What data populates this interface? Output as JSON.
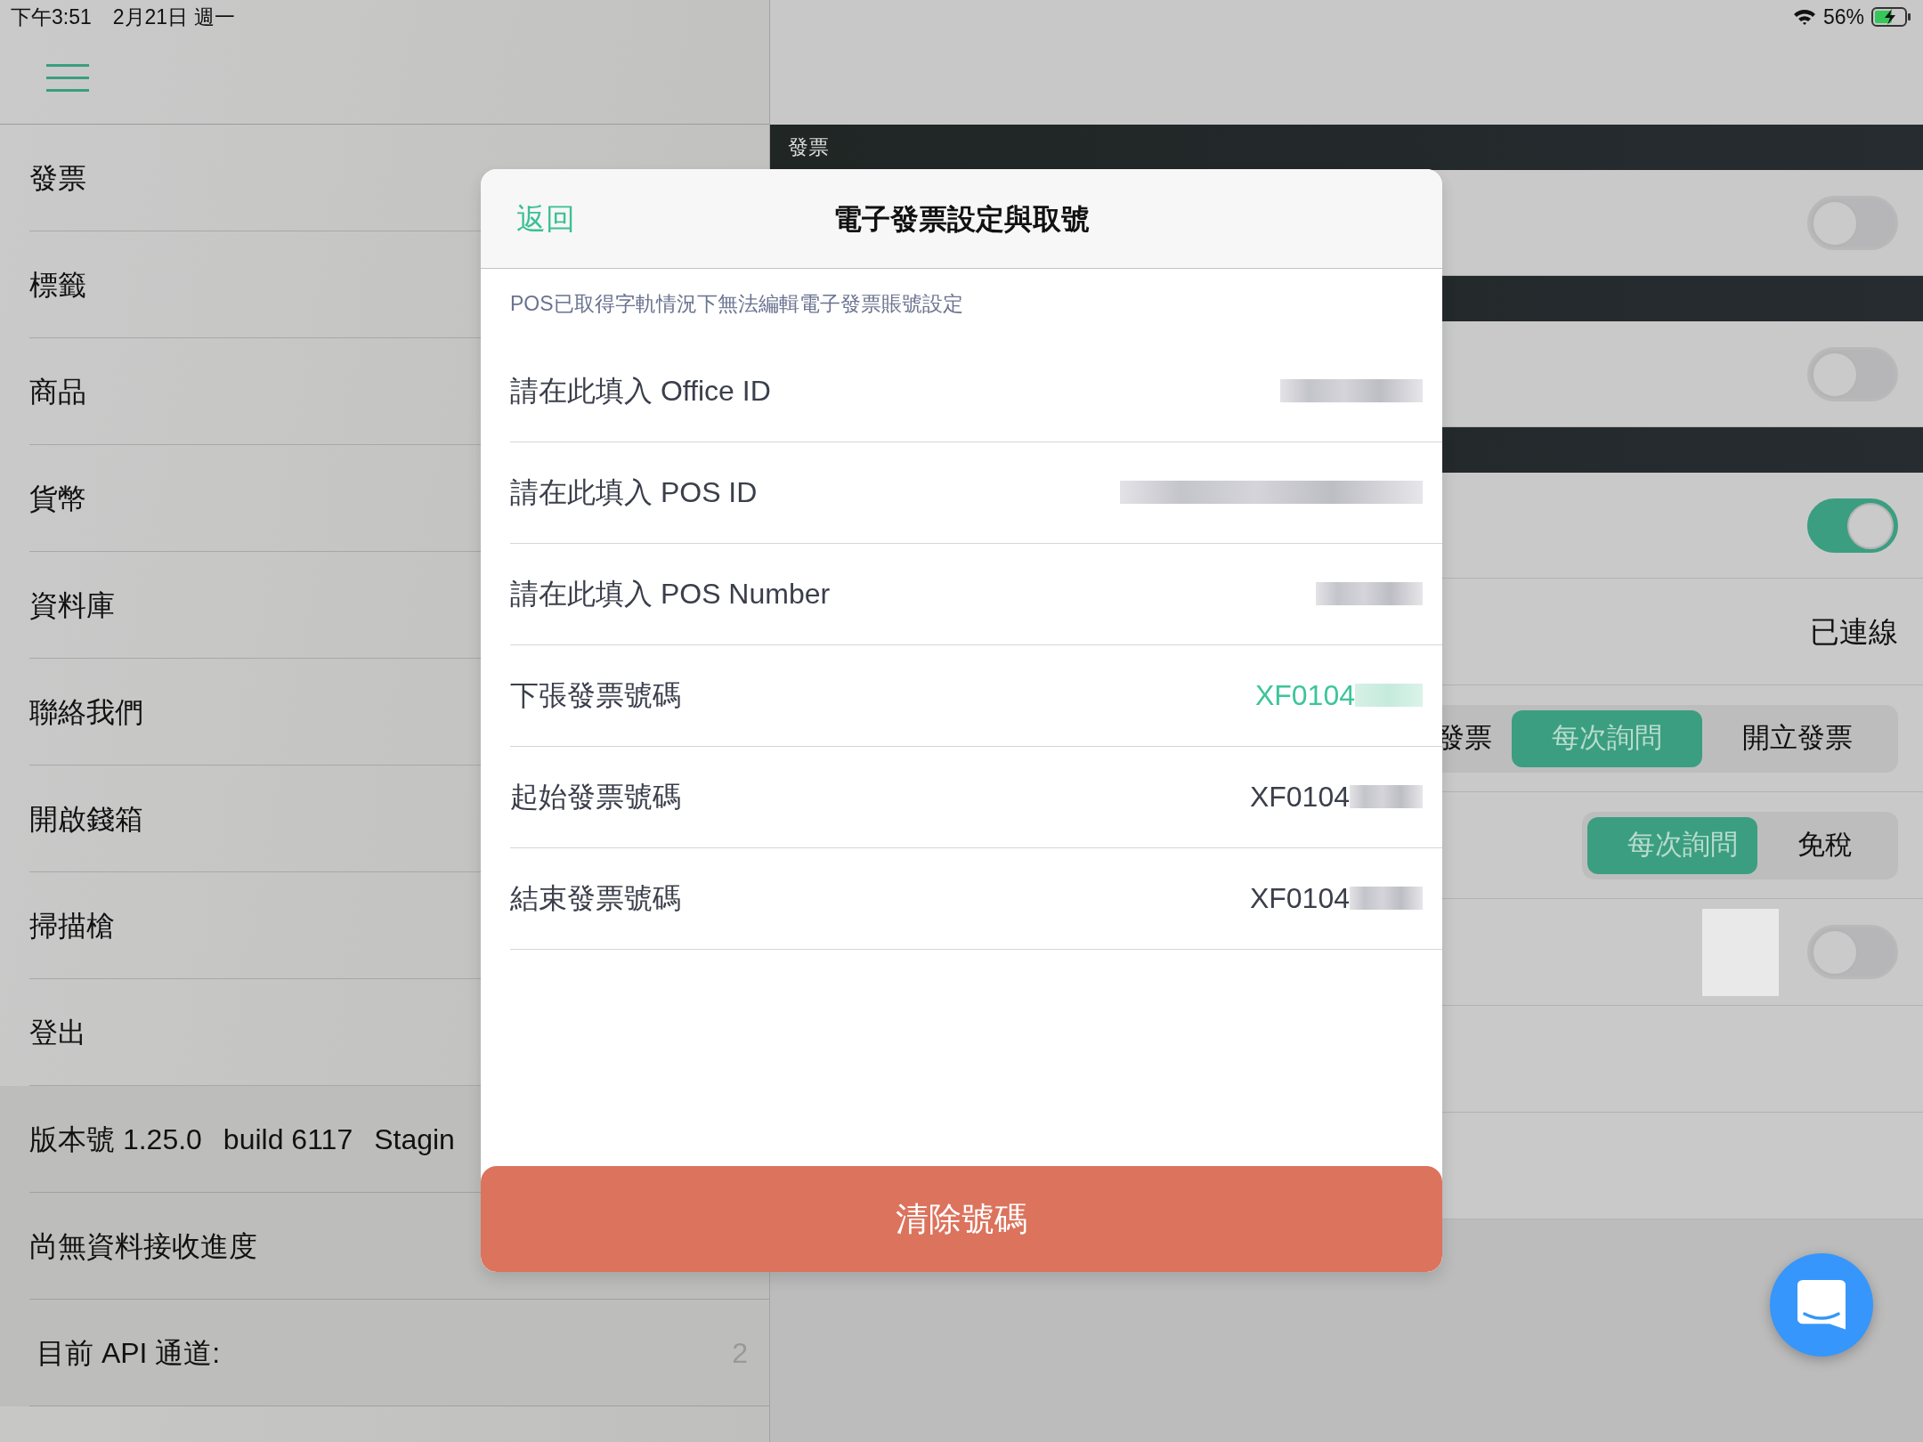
{
  "status_bar": {
    "time": "下午3:51",
    "date": "2月21日 週一",
    "battery": "56%",
    "charging": true
  },
  "sidebar": {
    "items": [
      {
        "label": "發票"
      },
      {
        "label": "標籤"
      },
      {
        "label": "商品"
      },
      {
        "label": "貨幣"
      },
      {
        "label": "資料庫"
      },
      {
        "label": "聯絡我們"
      },
      {
        "label": "開啟錢箱"
      },
      {
        "label": "掃描槍"
      },
      {
        "label": "登出"
      }
    ],
    "version": [
      "版本號 1.25.0",
      "build 6117",
      "Stagin"
    ],
    "progress": "尚無資料接收進度",
    "api_channel": {
      "label": "目前 API 通道:",
      "value": "2"
    }
  },
  "main": {
    "sections": [
      {
        "kind": "header",
        "label": "發票"
      },
      {
        "kind": "toggle",
        "on": false
      },
      {
        "kind": "header"
      },
      {
        "kind": "toggle",
        "on": false
      },
      {
        "kind": "header"
      },
      {
        "kind": "toggle",
        "on": true
      },
      {
        "kind": "status",
        "value": "已連線"
      },
      {
        "kind": "segment",
        "options": [
          {
            "label": "發票",
            "selected": false
          },
          {
            "label": "每次詢問",
            "selected": true
          },
          {
            "label": "開立發票",
            "selected": false
          }
        ]
      },
      {
        "kind": "segment",
        "options": [
          {
            "label": "每次詢問",
            "selected": true
          },
          {
            "label": "免稅",
            "selected": false
          }
        ]
      },
      {
        "kind": "image_toggle",
        "on": false
      },
      {
        "kind": "empty"
      },
      {
        "kind": "empty"
      }
    ]
  },
  "dialog": {
    "back": "返回",
    "title": "電子發票設定與取號",
    "note": "POS已取得字軌情況下無法編輯電子發票賬號設定",
    "rows": [
      {
        "label": "請在此填入 Office ID"
      },
      {
        "label": "請在此填入 POS ID"
      },
      {
        "label": "請在此填入 POS Number"
      },
      {
        "label": "下張發票號碼",
        "value": "XF0104",
        "highlighted": true
      },
      {
        "label": "起始發票號碼",
        "value": "XF0104",
        "highlighted": false
      },
      {
        "label": "結束發票號碼",
        "value": "XF0104",
        "highlighted": false
      }
    ],
    "clear_button": "清除號碼"
  }
}
